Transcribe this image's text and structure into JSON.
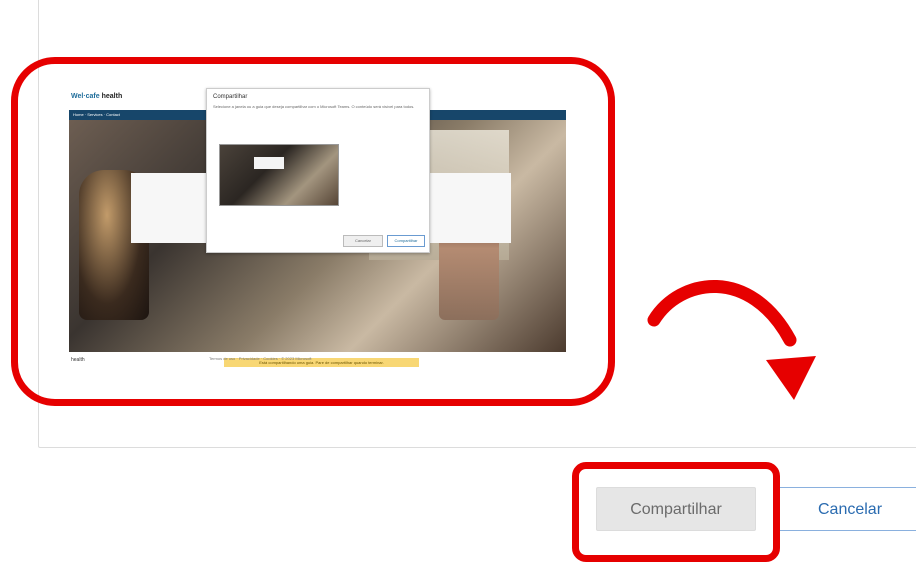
{
  "preview": {
    "brand_prefix": "Wel·cafe",
    "brand_name": "health",
    "nav_text": "Home · Services · Contact",
    "dialog_title": "Compartilhar",
    "dialog_text": "Selecione a janela ou a guia que deseja compartilhar com o Microsoft Teams. O conteúdo será visível para todos.",
    "dialog_cancel": "Cancelar",
    "dialog_share": "Compartilhar",
    "banner_text": "Está compartilhando uma guia. Pare de compartilhar quando terminar.",
    "footer_logo": "health",
    "footer_text": "Termos de uso · Privacidade · Cookies · © 2023 Microsoft"
  },
  "actions": {
    "share_label": "Compartilhar",
    "cancel_label": "Cancelar"
  },
  "colors": {
    "highlight": "#e60000",
    "arrow": "#e60000",
    "cancel_text": "#2a6bb0"
  },
  "icons": {
    "arrow": "curved-arrow-icon"
  }
}
